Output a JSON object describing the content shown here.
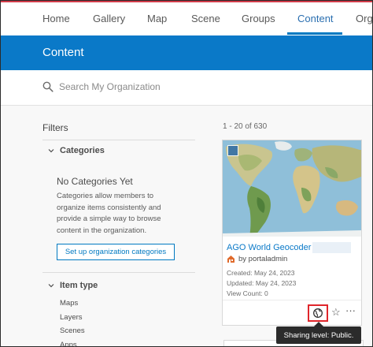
{
  "topnav": {
    "items": [
      {
        "label": "Home"
      },
      {
        "label": "Gallery"
      },
      {
        "label": "Map"
      },
      {
        "label": "Scene"
      },
      {
        "label": "Groups"
      },
      {
        "label": "Content",
        "active": true
      },
      {
        "label": "Orga"
      }
    ]
  },
  "header": {
    "title": "Content"
  },
  "search": {
    "placeholder": "Search My Organization"
  },
  "filters": {
    "title": "Filters",
    "categories": {
      "label": "Categories",
      "empty_title": "No Categories Yet",
      "empty_desc": "Categories allow members to organize items consistently and provide a simple way to browse content in the organization.",
      "setup_button": "Set up organization categories"
    },
    "item_type": {
      "label": "Item type",
      "types": [
        "Maps",
        "Layers",
        "Scenes",
        "Apps"
      ]
    }
  },
  "results": {
    "count_label": "1 - 20 of 630",
    "card": {
      "title": "AGO World Geocoder",
      "owner": "by portaladmin",
      "created": "Created: May 24, 2023",
      "updated": "Updated: May 24, 2023",
      "views": "View Count: 0",
      "share_icon": "globe-share-icon",
      "star_icon": "star-outline-icon",
      "more_icon": "ellipsis-icon"
    }
  },
  "tooltip": {
    "text": "Sharing level: Public."
  },
  "colors": {
    "brand_blue": "#0a79c8",
    "highlight_red": "#e0262b",
    "nav_red": "#d23c4a"
  }
}
